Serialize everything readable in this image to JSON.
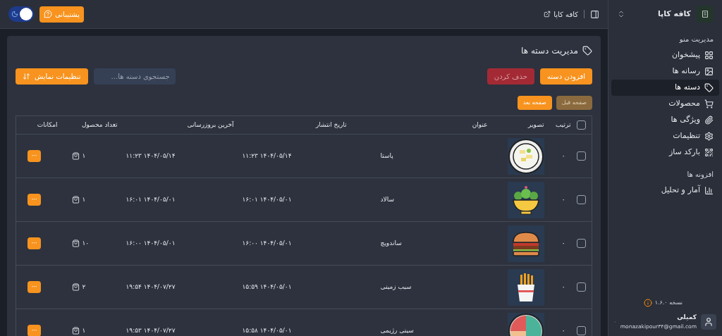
{
  "sidebar": {
    "brand": "کافه کاپا",
    "sections": [
      {
        "title": "مدیریت منو",
        "items": [
          {
            "label": "پیشخوان",
            "selected": false
          },
          {
            "label": "رسانه ها",
            "selected": false
          },
          {
            "label": "دسته ها",
            "selected": true
          },
          {
            "label": "محصولات",
            "selected": false
          },
          {
            "label": "ویژگی ها",
            "selected": false
          },
          {
            "label": "تنظیمات",
            "selected": false
          },
          {
            "label": "بارکد ساز",
            "selected": false
          }
        ]
      },
      {
        "title": "افزونه ها",
        "items": [
          {
            "label": "آمار و تحلیل",
            "selected": false
          }
        ]
      }
    ],
    "version": "نسخه ۱.۶.۰",
    "user": {
      "name": "کمیلی",
      "email": "monazakipour۳۴@gmail.com"
    }
  },
  "topbar": {
    "site_link": "کافه کاپا",
    "support_button": "پشتیبانی",
    "dark_mode": true
  },
  "page": {
    "title": "مدیریت دسته ها",
    "add_button": "افزودن دسته",
    "delete_button": "حذف کردن",
    "search": {
      "placeholder": "جستجوی دسته ها..."
    },
    "display_settings_button": "تنظیمات نمایش",
    "pagination": [
      {
        "label": "صفحه قبل",
        "disabled": true
      },
      {
        "label": "صفحه بعد",
        "disabled": false
      }
    ],
    "table": {
      "columns": [
        "ترتیب",
        "تصویر",
        "عنوان",
        "تاریخ انتشار",
        "آخرین بروزرسانی",
        "تعداد محصول",
        "امکانات"
      ],
      "all_checked": false,
      "rows": [
        {
          "checked": false,
          "order": "۰",
          "title": "پاستا",
          "published": "۱۴۰۴/۰۵/۱۴ ۱۱:۲۳",
          "updated": "۱۴۰۴/۰۵/۱۴ ۱۱:۲۳",
          "count": "۱",
          "actions": "···"
        },
        {
          "checked": false,
          "order": "۰",
          "title": "سالاد",
          "published": "۱۴۰۴/۰۵/۰۱ ۱۶:۰۱",
          "updated": "۱۴۰۴/۰۵/۰۱ ۱۶:۰۱",
          "count": "۱",
          "actions": "···"
        },
        {
          "checked": false,
          "order": "۰",
          "title": "ساندویچ",
          "published": "۱۴۰۴/۰۵/۰۱ ۱۶:۰۰",
          "updated": "۱۴۰۴/۰۵/۰۱ ۱۶:۰۰",
          "count": "۱۰",
          "actions": "···"
        },
        {
          "checked": false,
          "order": "۰",
          "title": "سیب زمینی",
          "published": "۱۴۰۴/۰۵/۰۱ ۱۵:۵۹",
          "updated": "۱۴۰۴/۰۷/۲۷ ۱۹:۵۴",
          "count": "۲",
          "actions": "···"
        },
        {
          "checked": false,
          "order": "۰",
          "title": "سینی رژیمی",
          "published": "۱۴۰۴/۰۵/۰۱ ۱۵:۵۸",
          "updated": "۱۴۰۴/۰۷/۲۷ ۱۹:۵۳",
          "count": "۱",
          "actions": "···"
        }
      ]
    }
  }
}
